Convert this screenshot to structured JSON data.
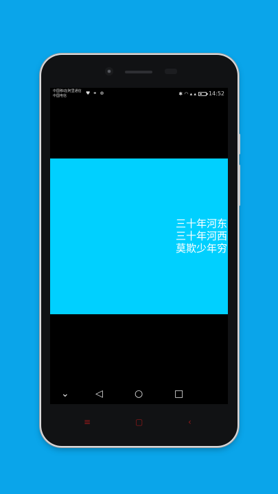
{
  "status_bar": {
    "carrier1": "中国移动|阿里通信",
    "carrier2": "中国电信",
    "left_icons": "♥ ⚭ ⊕",
    "right_icons": "✱ ◠ ▴ ▴",
    "time": "14:52",
    "battery_level": 0.4
  },
  "app": {
    "background_color": "#00d0ff",
    "poem_lines": [
      "三十年河东",
      "三十年河西",
      "莫欺少年穷"
    ]
  },
  "nav_bar": {
    "down_glyph": "⌄",
    "back_glyph": "◁",
    "home_glyph": "○",
    "recent_glyph": "□"
  },
  "hardware_keys": {
    "menu_glyph": "≡",
    "home_glyph": "▢",
    "back_glyph": "‹"
  }
}
